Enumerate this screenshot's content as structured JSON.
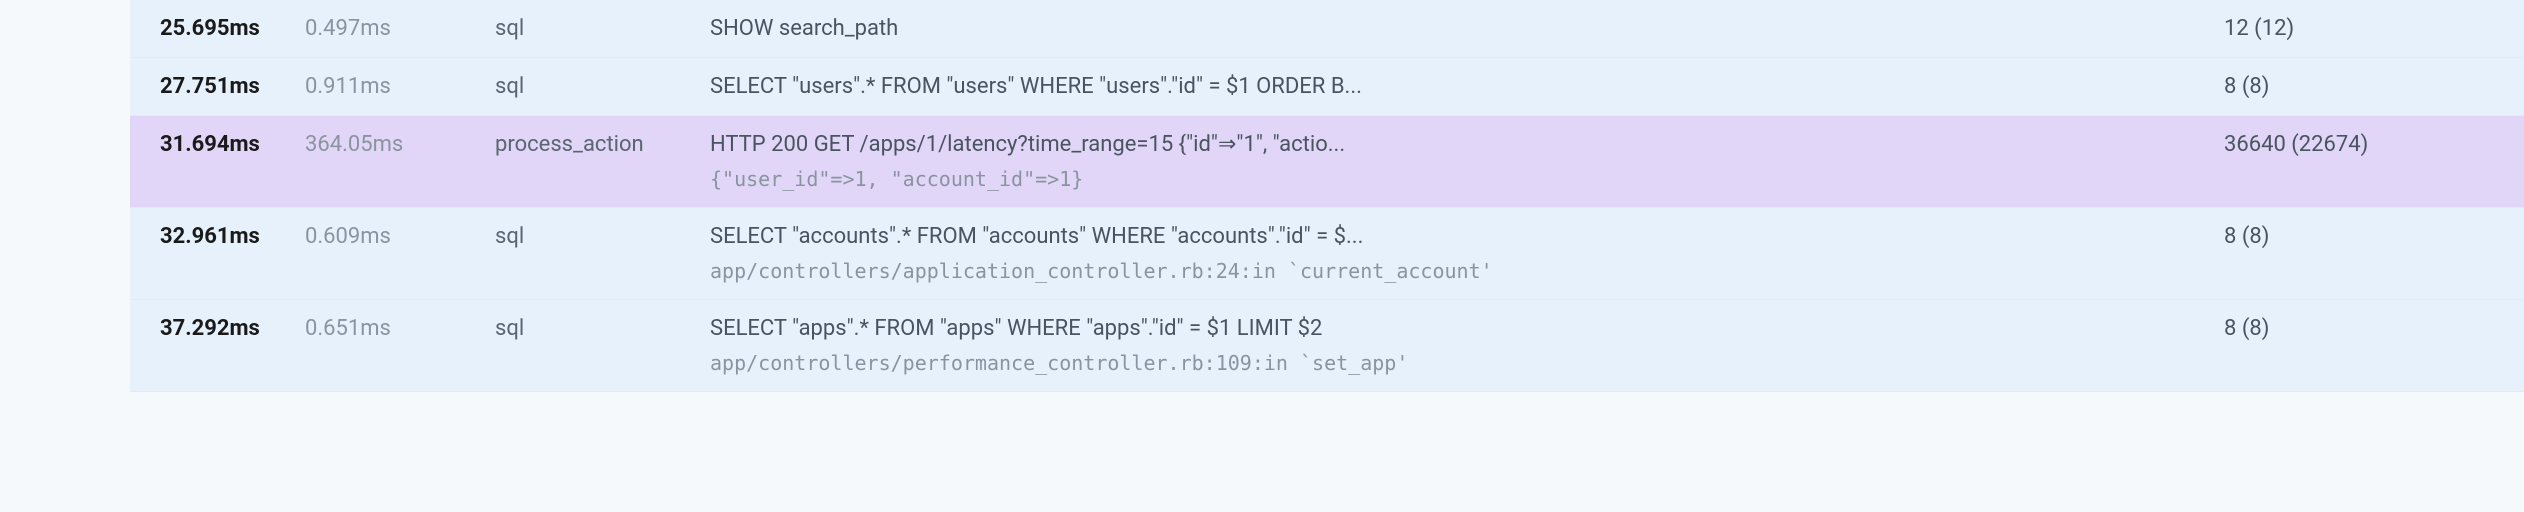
{
  "rows": [
    {
      "highlight": false,
      "t1": "25.695ms",
      "t2": "0.497ms",
      "category": "sql",
      "desc": "SHOW search_path",
      "sub": null,
      "count": "12 (12)"
    },
    {
      "highlight": false,
      "t1": "27.751ms",
      "t2": "0.911ms",
      "category": "sql",
      "desc": "SELECT \"users\".* FROM \"users\" WHERE \"users\".\"id\" = $1 ORDER B...",
      "sub": null,
      "count": "8 (8)"
    },
    {
      "highlight": true,
      "t1": "31.694ms",
      "t2": "364.05ms",
      "category": "process_action",
      "desc": "HTTP 200 GET /apps/1/latency?time_range=15 {\"id\"⇒\"1\", \"actio...",
      "sub": "{\"user_id\"=>1, \"account_id\"=>1}",
      "count": "36640 (22674)"
    },
    {
      "highlight": false,
      "t1": "32.961ms",
      "t2": "0.609ms",
      "category": "sql",
      "desc": "SELECT \"accounts\".* FROM \"accounts\" WHERE \"accounts\".\"id\" = $...",
      "sub": "app/controllers/application_controller.rb:24:in `current_account'",
      "count": "8 (8)"
    },
    {
      "highlight": false,
      "t1": "37.292ms",
      "t2": "0.651ms",
      "category": "sql",
      "desc": "SELECT \"apps\".* FROM \"apps\" WHERE \"apps\".\"id\" = $1 LIMIT $2",
      "sub": "app/controllers/performance_controller.rb:109:in `set_app'",
      "count": "8 (8)"
    }
  ]
}
